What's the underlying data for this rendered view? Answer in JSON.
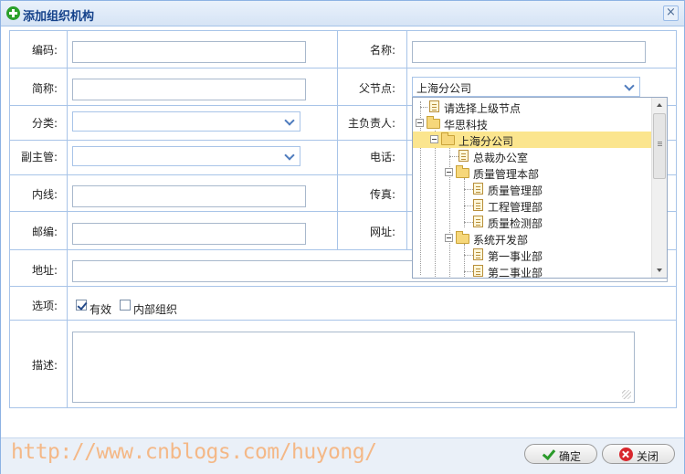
{
  "window": {
    "title": "添加组织机构",
    "close_glyph": "×",
    "title_icon": "green-plus-icon"
  },
  "form": {
    "code_label": "编码:",
    "name_label": "名称:",
    "short_name_label": "简称:",
    "parent_label": "父节点:",
    "parent_value": "上海分公司",
    "category_label": "分类:",
    "manager_label": "主负责人:",
    "deputy_label": "副主管:",
    "phone_label": "电话:",
    "extension_label": "内线:",
    "fax_label": "传真:",
    "zip_label": "邮编:",
    "website_label": "网址:",
    "address_label": "地址:",
    "options_label": "选项:",
    "opt_valid": "有效",
    "opt_valid_checked": true,
    "opt_internal": "内部组织",
    "opt_internal_checked": false,
    "desc_label": "描述:"
  },
  "tree": {
    "items": [
      {
        "label": "请选择上级节点",
        "icon": "document-icon"
      },
      {
        "label": "华思科技",
        "icon": "folder-icon"
      },
      {
        "label": "上海分公司",
        "icon": "folder-icon",
        "selected": true
      },
      {
        "label": "总裁办公室",
        "icon": "document-icon"
      },
      {
        "label": "质量管理本部",
        "icon": "folder-icon"
      },
      {
        "label": "质量管理部",
        "icon": "document-icon"
      },
      {
        "label": "工程管理部",
        "icon": "document-icon"
      },
      {
        "label": "质量检测部",
        "icon": "document-icon"
      },
      {
        "label": "系统开发部",
        "icon": "folder-icon"
      },
      {
        "label": "第一事业部",
        "icon": "document-icon"
      },
      {
        "label": "第二事业部",
        "icon": "document-icon"
      }
    ]
  },
  "footer": {
    "watermark": "http://www.cnblogs.com/huyong/",
    "ok_label": "确定",
    "close_label": "关闭"
  }
}
